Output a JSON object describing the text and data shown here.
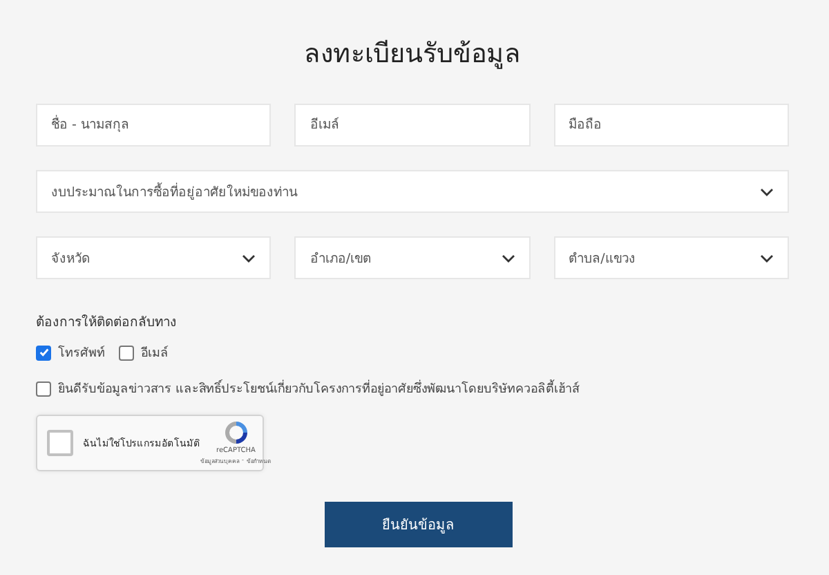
{
  "title": "ลงทะเบียนรับข้อมูล",
  "fields": [
    {
      "placeholder": "ชื่อ - นามสกุล"
    },
    {
      "placeholder": "อีเมล์"
    },
    {
      "placeholder": "มือถือ"
    }
  ],
  "budget_dropdown": {
    "placeholder": "งบประมาณในการซื้อที่อยู่อาศัยใหม่ของท่าน"
  },
  "location_dropdowns": [
    {
      "placeholder": "จังหวัด"
    },
    {
      "placeholder": "อำเภอ/เขต"
    },
    {
      "placeholder": "ตำบล/แขวง"
    }
  ],
  "contact_label": "ต้องการให้ติดต่อกลับทาง",
  "contact_options": [
    {
      "label": "โทรศัพท์",
      "checked": true
    },
    {
      "label": "อีเมล์",
      "checked": false
    }
  ],
  "consent": {
    "label": "ยินดีรับข้อมูลข่าวสาร และสิทธิ์ประโยชน์เกี่ยวกับโครงการที่อยู่อาศัยซึ่งพัฒนาโดยบริษัทควอลิตี้เฮ้าส์",
    "checked": false
  },
  "captcha": {
    "label": "ฉันไม่ใช่โปรแกรมอัตโนมัติ",
    "checked": false,
    "brand": "reCAPTCHA",
    "privacy": "ข้อมูลส่วนบุคคล",
    "separator": "-",
    "terms": "ข้อกำหนด"
  },
  "submit_button": "ยืนยันข้อมูล"
}
